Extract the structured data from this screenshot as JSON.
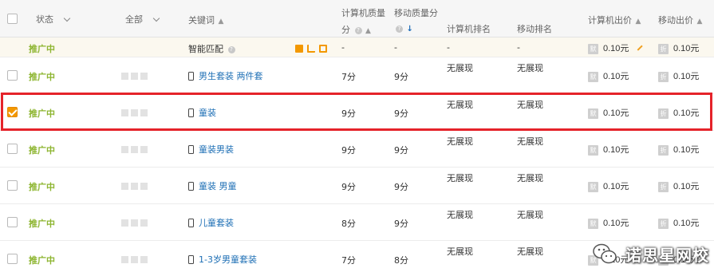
{
  "header": {
    "status_label": "状态",
    "all_label": "全部",
    "keyword_label": "关键词",
    "pc_quality_line1": "计算机质量",
    "pc_quality_line2": "分",
    "mobile_quality_label": "移动质量分",
    "pc_rank_label": "计算机排名",
    "mobile_rank_label": "移动排名",
    "pc_bid_label": "计算机出价",
    "mobile_bid_label": "移动出价"
  },
  "smart_match": {
    "status": "推广中",
    "keyword": "智能匹配",
    "pc_quality": "-",
    "mobile_quality": "-",
    "pc_rank": "-",
    "mobile_rank": "-",
    "pc_badge": "默",
    "pc_bid": "0.10元",
    "mobile_badge": "折",
    "mobile_bid": "0.10元"
  },
  "rows": [
    {
      "status": "推广中",
      "keyword": "男生套装 两件套",
      "pc_quality": "7分",
      "mobile_quality": "9分",
      "pc_rank": "无展现",
      "mobile_rank": "无展现",
      "pc_badge": "默",
      "pc_bid": "0.10元",
      "mobile_badge": "折",
      "mobile_bid": "0.10元",
      "checked": false
    },
    {
      "status": "推广中",
      "keyword": "童装",
      "pc_quality": "9分",
      "mobile_quality": "9分",
      "pc_rank": "无展现",
      "mobile_rank": "无展现",
      "pc_badge": "默",
      "pc_bid": "0.10元",
      "mobile_badge": "折",
      "mobile_bid": "0.10元",
      "checked": true
    },
    {
      "status": "推广中",
      "keyword": "童装男装",
      "pc_quality": "9分",
      "mobile_quality": "9分",
      "pc_rank": "无展现",
      "mobile_rank": "无展现",
      "pc_badge": "默",
      "pc_bid": "0.10元",
      "mobile_badge": "折",
      "mobile_bid": "0.10元",
      "checked": false
    },
    {
      "status": "推广中",
      "keyword": "童装 男童",
      "pc_quality": "9分",
      "mobile_quality": "9分",
      "pc_rank": "无展现",
      "mobile_rank": "无展现",
      "pc_badge": "默",
      "pc_bid": "0.10元",
      "mobile_badge": "折",
      "mobile_bid": "0.10元",
      "checked": false
    },
    {
      "status": "推广中",
      "keyword": "儿童套装",
      "pc_quality": "8分",
      "mobile_quality": "9分",
      "pc_rank": "无展现",
      "mobile_rank": "无展现",
      "pc_badge": "默",
      "pc_bid": "0.10元",
      "mobile_badge": "折",
      "mobile_bid": "0.10元",
      "checked": false
    },
    {
      "status": "推广中",
      "keyword": "1-3岁男童套装",
      "pc_quality": "7分",
      "mobile_quality": "8分",
      "pc_rank": "无展现",
      "mobile_rank": "无展现",
      "pc_badge": "默",
      "pc_bid": "0.10元",
      "mobile_badge": "折",
      "mobile_bid": "0.10元",
      "checked": false
    }
  ],
  "watermark": {
    "text": "诺思星网校"
  },
  "colors": {
    "status_green": "#8db530",
    "keyword_blue": "#1e6fb5",
    "checkbox_orange": "#f39800",
    "highlight_red": "#e5232a"
  },
  "icons": {
    "keyword_device": "mobile-phone-icon",
    "sort": "sort-arrow-icon",
    "help": "question-icon",
    "edit": "pencil-icon",
    "wechat": "wechat-icon"
  }
}
